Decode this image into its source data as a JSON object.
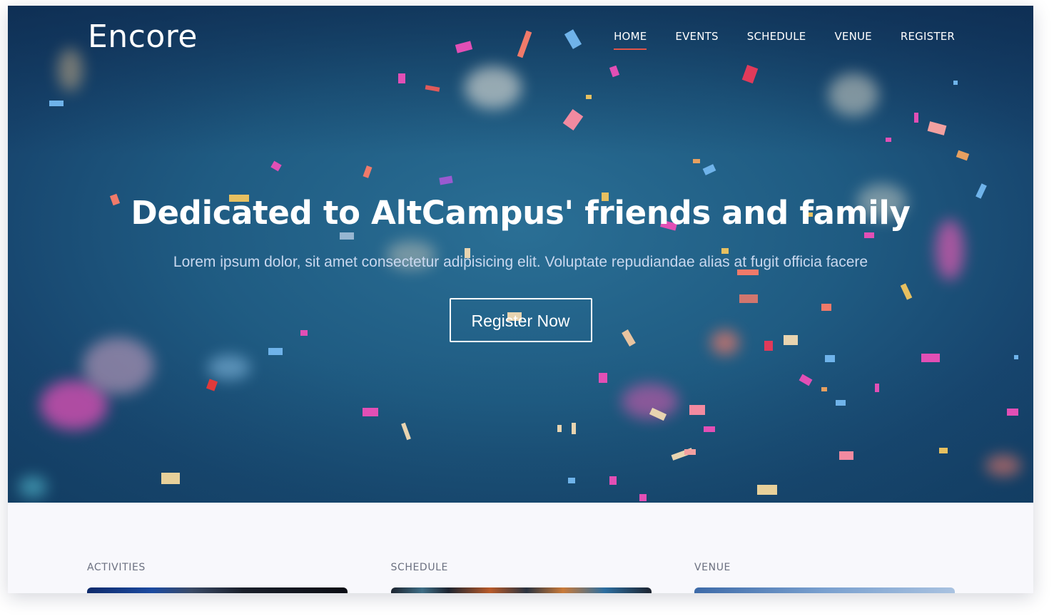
{
  "brand": {
    "logo_text": "Encore"
  },
  "nav": {
    "items": [
      {
        "label": "HOME",
        "active": true
      },
      {
        "label": "EVENTS",
        "active": false
      },
      {
        "label": "SCHEDULE",
        "active": false
      },
      {
        "label": "VENUE",
        "active": false
      },
      {
        "label": "REGISTER",
        "active": false
      }
    ],
    "active_indicator_color": "#e25549"
  },
  "hero": {
    "title": "Dedicated to AltCampus' friends and family",
    "subtitle": "Lorem ipsum dolor, sit amet consectetur adipisicing elit. Voluptate repudiandae alias at fugit officia facere",
    "cta_label": "Register Now",
    "background_color": "#1f5b82"
  },
  "sections": [
    {
      "label": "ACTIVITIES"
    },
    {
      "label": "SCHEDULE"
    },
    {
      "label": "VENUE"
    }
  ]
}
